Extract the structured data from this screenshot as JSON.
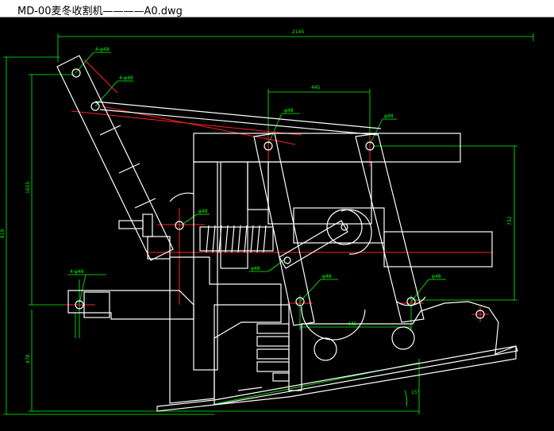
{
  "window": {
    "title": "MD-00麦冬收割机————A0.dwg"
  },
  "drawing": {
    "background": "#000000",
    "line_color": "#ffffff",
    "dimension_color": "#00ff00",
    "centerline_color": "#ff2020",
    "dimensions": {
      "overall_width": "2145",
      "overall_height": "619",
      "left_height": "1655",
      "bottom_height": "478",
      "top_span": "445",
      "bottom_span": "445",
      "right_height": "732",
      "angle": "15°"
    },
    "hole_labels": {
      "top_left_hole": "4-φ48",
      "upper_arm_hole": "4-φ48",
      "link_hole_1": "φ48",
      "link_hole_2": "φ48",
      "spring_hole": "φ48",
      "left_base_hole": "4-φ48",
      "lower_link_hole": "φ48",
      "bottom_hole_1": "φ48",
      "bottom_hole_2": "φ48"
    }
  }
}
